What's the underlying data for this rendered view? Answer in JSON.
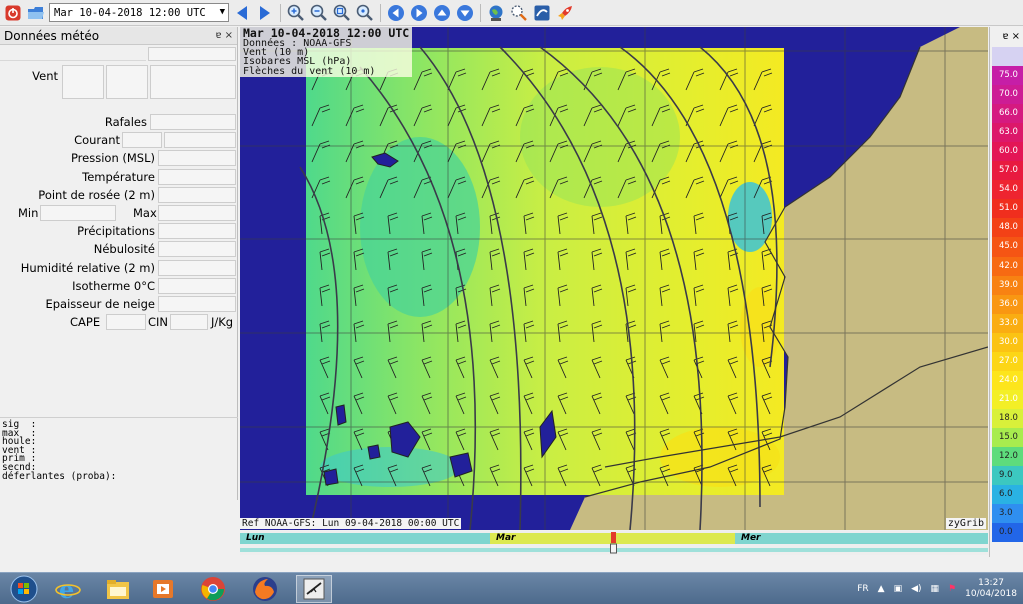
{
  "toolbar": {
    "date_value": "Mar 10-04-2018 12:00 UTC",
    "icons": [
      "close-icon",
      "open-folder-icon",
      "prev-arrow-icon",
      "next-arrow-icon",
      "zoom-in-icon",
      "zoom-out-icon",
      "zoom-fit-icon",
      "zoom-reset-icon",
      "pan-left-icon",
      "pan-right-icon",
      "pan-up-icon",
      "pan-down-icon",
      "globe-icon",
      "select-zone-icon",
      "grib-icon",
      "rocket-icon"
    ]
  },
  "left_panel": {
    "title": "Données météo",
    "title_controls": "ɐ ×",
    "rows": {
      "vent": "Vent",
      "rafales": "Rafales",
      "courant": "Courant",
      "pression": "Pression (MSL)",
      "temperature": "Température",
      "rosee": "Point de rosée (2 m)",
      "min": "Min",
      "max": "Max",
      "precip": "Précipitations",
      "nebulosite": "Nébulosité",
      "humidite": "Humidité relative (2 m)",
      "isotherme": "Isotherme 0°C",
      "neige": "Epaisseur de neige",
      "cape": "CAPE",
      "cin": "CIN",
      "jkg": "J/Kg"
    },
    "wave_info": "sig  :\nmax  :\nhoule:\nvent :\nprim :\nsecnd:\ndéferlantes (proba):"
  },
  "map": {
    "info_title": "Mar 10-04-2018 12:00 UTC",
    "info_lines": [
      "Données : NOAA-GFS",
      "Vent (10 m)",
      "Isobares MSL (hPa)",
      "Flèches du vent (10 m)"
    ],
    "ref": "Ref NOAA-GFS: Lun 09-04-2018 00:00 UTC",
    "brand": "zyGrib",
    "colors": {
      "sea": "#22209a",
      "land": "#c7bb82"
    }
  },
  "timeline": {
    "days": [
      "Lun",
      "Mar",
      "Mer"
    ],
    "position_fraction": 0.497
  },
  "right_panel": {
    "title_controls": "ɐ ×",
    "legend": [
      {
        "label": "",
        "color": "#d6d2f2"
      },
      {
        "label": "75.0",
        "color": "#c61ea7"
      },
      {
        "label": "70.0",
        "color": "#cd1c95"
      },
      {
        "label": "66.0",
        "color": "#d51a80"
      },
      {
        "label": "63.0",
        "color": "#dc186a"
      },
      {
        "label": "60.0",
        "color": "#e31656"
      },
      {
        "label": "57.0",
        "color": "#e81a40"
      },
      {
        "label": "54.0",
        "color": "#ee2430"
      },
      {
        "label": "51.0",
        "color": "#f02e1e"
      },
      {
        "label": "48.0",
        "color": "#f34116"
      },
      {
        "label": "45.0",
        "color": "#f55514"
      },
      {
        "label": "42.0",
        "color": "#f76a12"
      },
      {
        "label": "39.0",
        "color": "#f88212"
      },
      {
        "label": "36.0",
        "color": "#f99712"
      },
      {
        "label": "33.0",
        "color": "#faad12"
      },
      {
        "label": "30.0",
        "color": "#fbc313"
      },
      {
        "label": "27.0",
        "color": "#fcd616"
      },
      {
        "label": "24.0",
        "color": "#fde51c"
      },
      {
        "label": "21.0",
        "color": "#f3ef26"
      },
      {
        "label": "18.0",
        "color": "#d9f03a"
      },
      {
        "label": "15.0",
        "color": "#a8ec4e"
      },
      {
        "label": "12.0",
        "color": "#5edc7c"
      },
      {
        "label": "9.0",
        "color": "#3cc8c0"
      },
      {
        "label": "6.0",
        "color": "#2ab2e3"
      },
      {
        "label": "3.0",
        "color": "#2f8ff0"
      },
      {
        "label": "0.0",
        "color": "#2266e8"
      }
    ]
  },
  "taskbar": {
    "apps": [
      "start-orb-icon",
      "ie-browser-icon",
      "file-explorer-icon",
      "media-player-icon",
      "chrome-icon",
      "firefox-icon",
      "zygrib-app-icon"
    ],
    "lang": "FR",
    "time": "13:27",
    "date": "10/04/2018"
  }
}
